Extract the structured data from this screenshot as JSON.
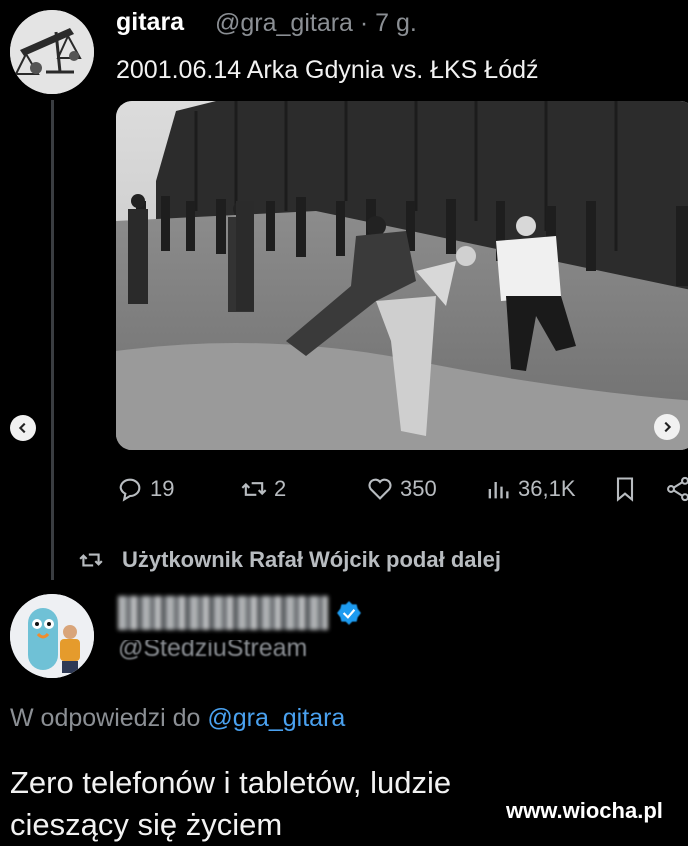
{
  "tweet": {
    "author_name": "gitara",
    "author_handle_time": "@gra_gitara · 7 g.",
    "text": "2001.06.14 Arka Gdynia vs. ŁKS Łódź",
    "avatar_icon": "scales-of-justice-avatar",
    "photo_icon": "crowd-fight-photo",
    "actions": {
      "replies": "19",
      "retweets": "2",
      "likes": "350",
      "views": "36,1K"
    }
  },
  "carousel": {
    "prev_icon": "chevron-left-icon",
    "next_icon": "chevron-right-icon"
  },
  "retweet_notice": "Użytkownik Rafał Wójcik podał dalej",
  "reply": {
    "handle_blurred": "@StedziuStream",
    "reply_to_prefix": "W odpowiedzi do",
    "reply_to_mention": "@gra_gitara",
    "text_line1": "Zero telefonów i tabletów, ludzie",
    "text_line2": "cieszący się życiem"
  },
  "watermark": "www.wiocha.pl",
  "colors": {
    "background": "#000000",
    "mention": "#4aa1ef",
    "verified": "#1d9bf0",
    "muted": "#8b8f94"
  }
}
